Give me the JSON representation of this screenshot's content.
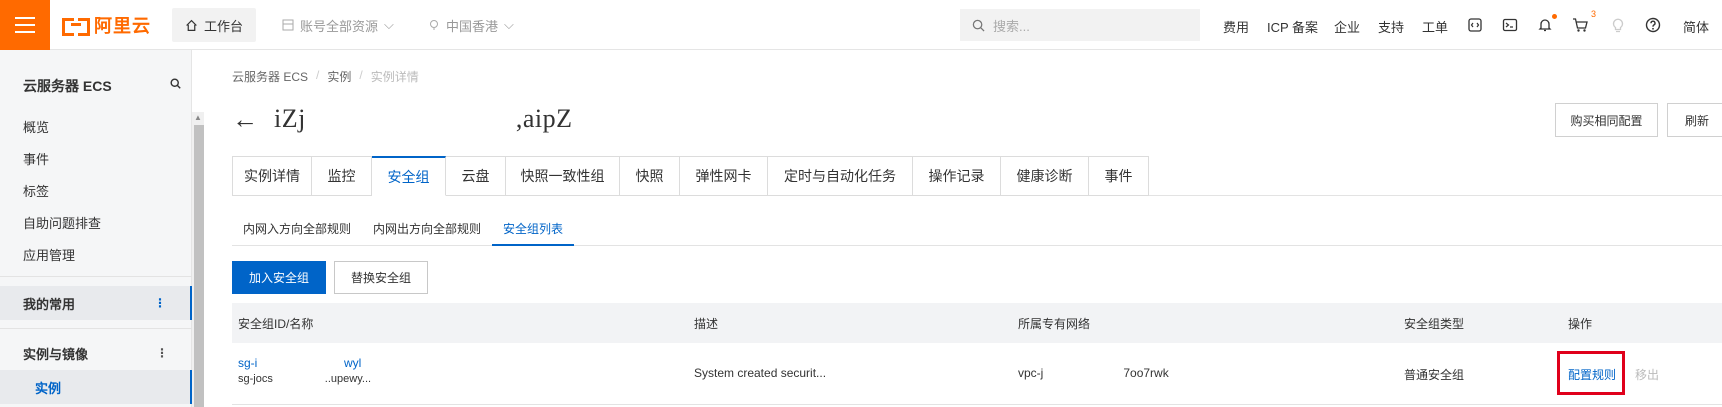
{
  "topbar": {
    "brand": "阿里云",
    "workbench": "工作台",
    "account_scope": "账号全部资源",
    "region": "中国香港",
    "search_placeholder": "搜索...",
    "links": [
      "费用",
      "ICP 备案",
      "企业",
      "支持",
      "工单"
    ],
    "cart_count": "3",
    "language": "简体",
    "accent_color": "#ff6a00"
  },
  "sidebar": {
    "title": "云服务器 ECS",
    "items": [
      "概览",
      "事件",
      "标签",
      "自助问题排查",
      "应用管理"
    ],
    "section_favorites": "我的常用",
    "section_instances": "实例与镜像",
    "active_item": "实例"
  },
  "breadcrumb": [
    "云服务器 ECS",
    "实例",
    "实例详情"
  ],
  "page": {
    "title": "iZj                              ,aipZ",
    "buy_same": "购买相同配置",
    "refresh": "刷新"
  },
  "tabs": [
    "实例详情",
    "监控",
    "安全组",
    "云盘",
    "快照一致性组",
    "快照",
    "弹性网卡",
    "定时与自动化任务",
    "操作记录",
    "健康诊断",
    "事件"
  ],
  "active_tab": "安全组",
  "subtabs": [
    "内网入方向全部规则",
    "内网出方向全部规则",
    "安全组列表"
  ],
  "active_subtab": "安全组列表",
  "actions": {
    "join": "加入安全组",
    "replace": "替换安全组"
  },
  "table": {
    "headers": [
      "安全组ID/名称",
      "描述",
      "所属专有网络",
      "安全组类型",
      "操作"
    ],
    "rows": [
      {
        "id": "sg-i                          wyl",
        "name": "sg-jocs                 ..upewy...",
        "description": "System created securit...",
        "vpc": "vpc-j                        7oo7rwk",
        "type": "普通安全组",
        "action_configure": "配置规则",
        "action_remove": "移出"
      }
    ]
  },
  "link_color": "#0064c8"
}
